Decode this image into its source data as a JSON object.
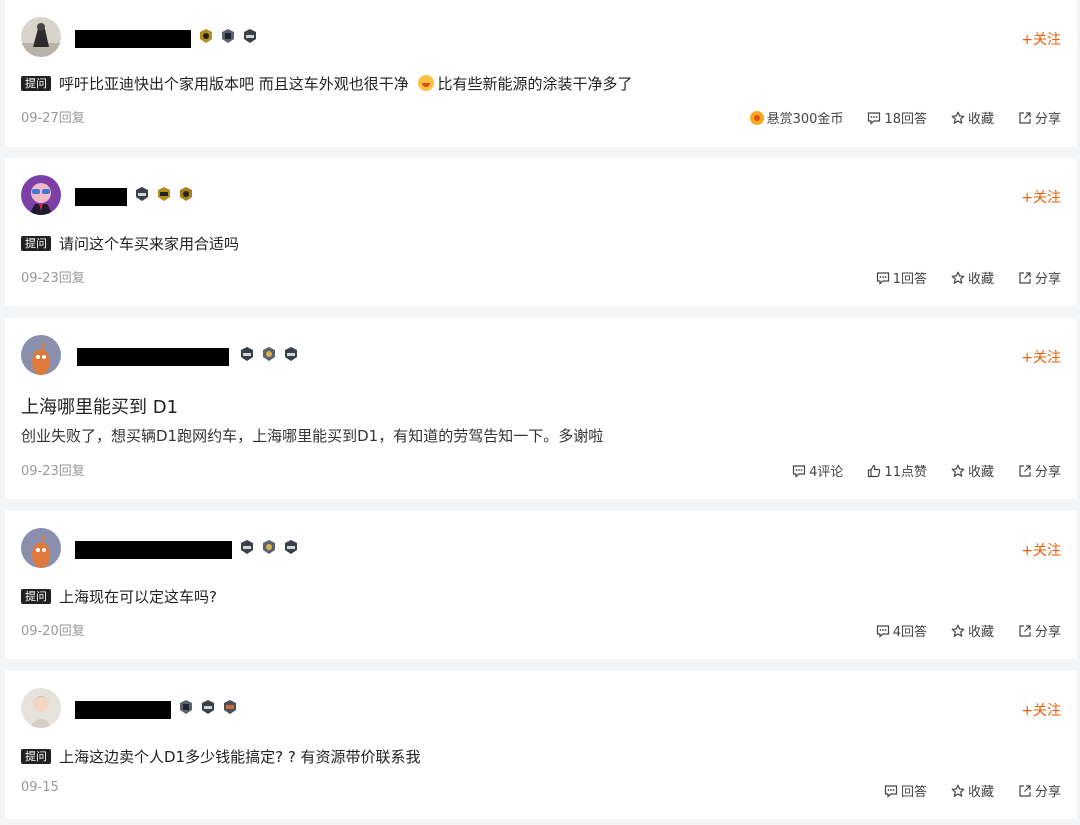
{
  "question_tag": "提问",
  "follow_label": "+关注",
  "posts": [
    {
      "content_pre": "呼吁比亚迪快出个家用版本吧 而且这车外观也很干净 ",
      "emoji": "grinning-face-emoji",
      "content_post": "比有些新能源的涂装干净多了",
      "date": "09-27回复",
      "actions": {
        "bounty": "悬赏300金币",
        "answers": "18回答",
        "favorite": "收藏",
        "share": "分享"
      }
    },
    {
      "content": "请问这个车买来家用合适吗",
      "date": "09-23回复",
      "actions": {
        "answers": "1回答",
        "favorite": "收藏",
        "share": "分享"
      }
    },
    {
      "title": "上海哪里能买到 D1",
      "content": "创业失败了，想买辆D1跑网约车，上海哪里能买到D1，有知道的劳驾告知一下。多谢啦",
      "date": "09-23回复",
      "actions": {
        "comments": "4评论",
        "likes": "11点赞",
        "favorite": "收藏",
        "share": "分享"
      }
    },
    {
      "content": "上海现在可以定这车吗?",
      "date": "09-20回复",
      "actions": {
        "answers": "4回答",
        "favorite": "收藏",
        "share": "分享"
      }
    },
    {
      "content": "上海这边卖个人D1多少钱能搞定? ? 有资源带价联系我",
      "date": "09-15",
      "actions": {
        "answers": "回答",
        "favorite": "收藏",
        "share": "分享"
      }
    }
  ],
  "colors": {
    "accent": "#f25c05",
    "tag_bg": "#222222",
    "page_bg": "#f4f5f7"
  }
}
